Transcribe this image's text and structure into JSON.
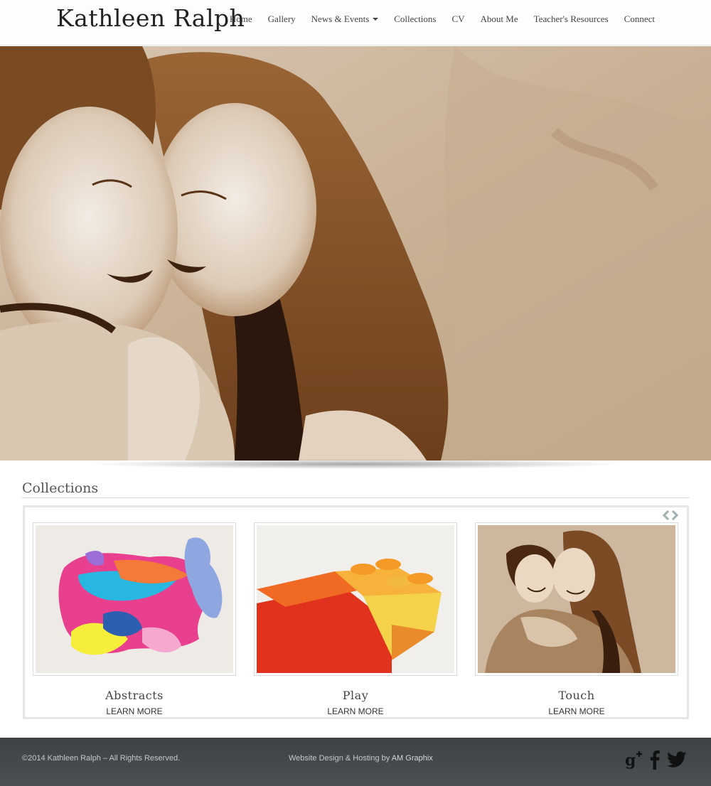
{
  "header": {
    "brand": "Kathleen Ralph",
    "nav": [
      {
        "label": "Home"
      },
      {
        "label": "Gallery"
      },
      {
        "label": "News & Events"
      },
      {
        "label": "Collections"
      },
      {
        "label": "CV"
      },
      {
        "label": "About Me"
      },
      {
        "label": "Teacher's Resources"
      },
      {
        "label": "Connect"
      }
    ]
  },
  "hero": {
    "image": "sepia-painting-two-children"
  },
  "collections": {
    "title": "Collections",
    "prev_icon": "chevron-left-icon",
    "next_icon": "chevron-right-icon",
    "items": [
      {
        "title": "Abstracts",
        "link": "LEARN MORE"
      },
      {
        "title": "Play",
        "link": "LEARN MORE"
      },
      {
        "title": "Touch",
        "link": "LEARN MORE"
      }
    ]
  },
  "footer": {
    "copyright": "©2014 Kathleen Ralph – All Rights Reserved.",
    "credit_prefix": "Website Design & Hosting by ",
    "credit_link": "AM Graphix",
    "social": [
      "google-plus-icon",
      "facebook-icon",
      "twitter-icon"
    ]
  },
  "colors": {
    "footer_bg": "#43484b",
    "sepia": "#7a4f2a",
    "accent_arrows": "#9fb0b0"
  }
}
